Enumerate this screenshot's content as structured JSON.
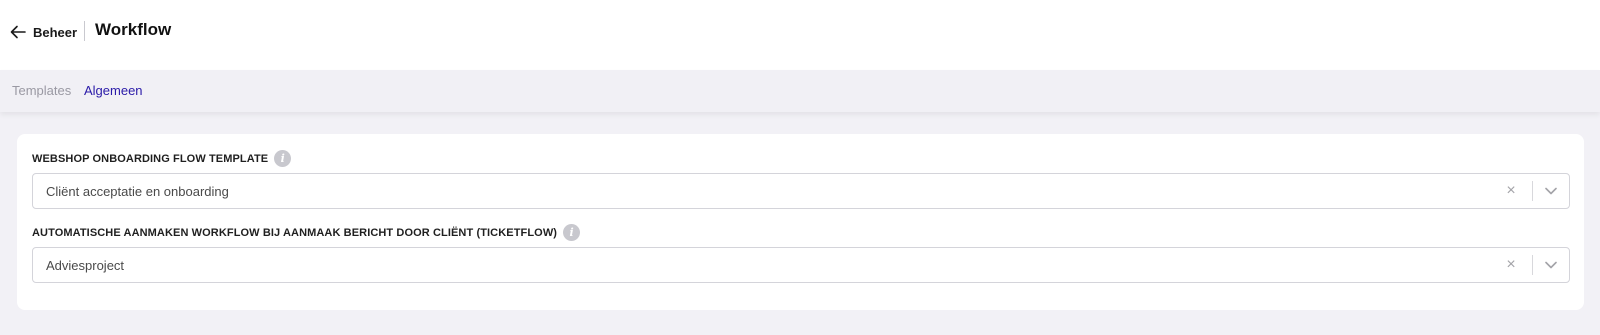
{
  "header": {
    "back_label": "Beheer",
    "title": "Workflow"
  },
  "tabs": [
    {
      "label": "Templates",
      "active": false
    },
    {
      "label": "Algemeen",
      "active": true
    }
  ],
  "fields": [
    {
      "label": "WEBSHOP ONBOARDING FLOW TEMPLATE",
      "value": "Cliënt acceptatie en onboarding"
    },
    {
      "label": "AUTOMATISCHE AANMAKEN WORKFLOW BIJ AANMAAK BERICHT DOOR CLIËNT (TICKETFLOW)",
      "value": "Adviesproject"
    }
  ],
  "icons": {
    "info": "i",
    "clear": "×"
  },
  "colors": {
    "active_tab": "#2a1aa8",
    "inactive_tab": "#9a99a3",
    "background": "#f2f1f6"
  }
}
